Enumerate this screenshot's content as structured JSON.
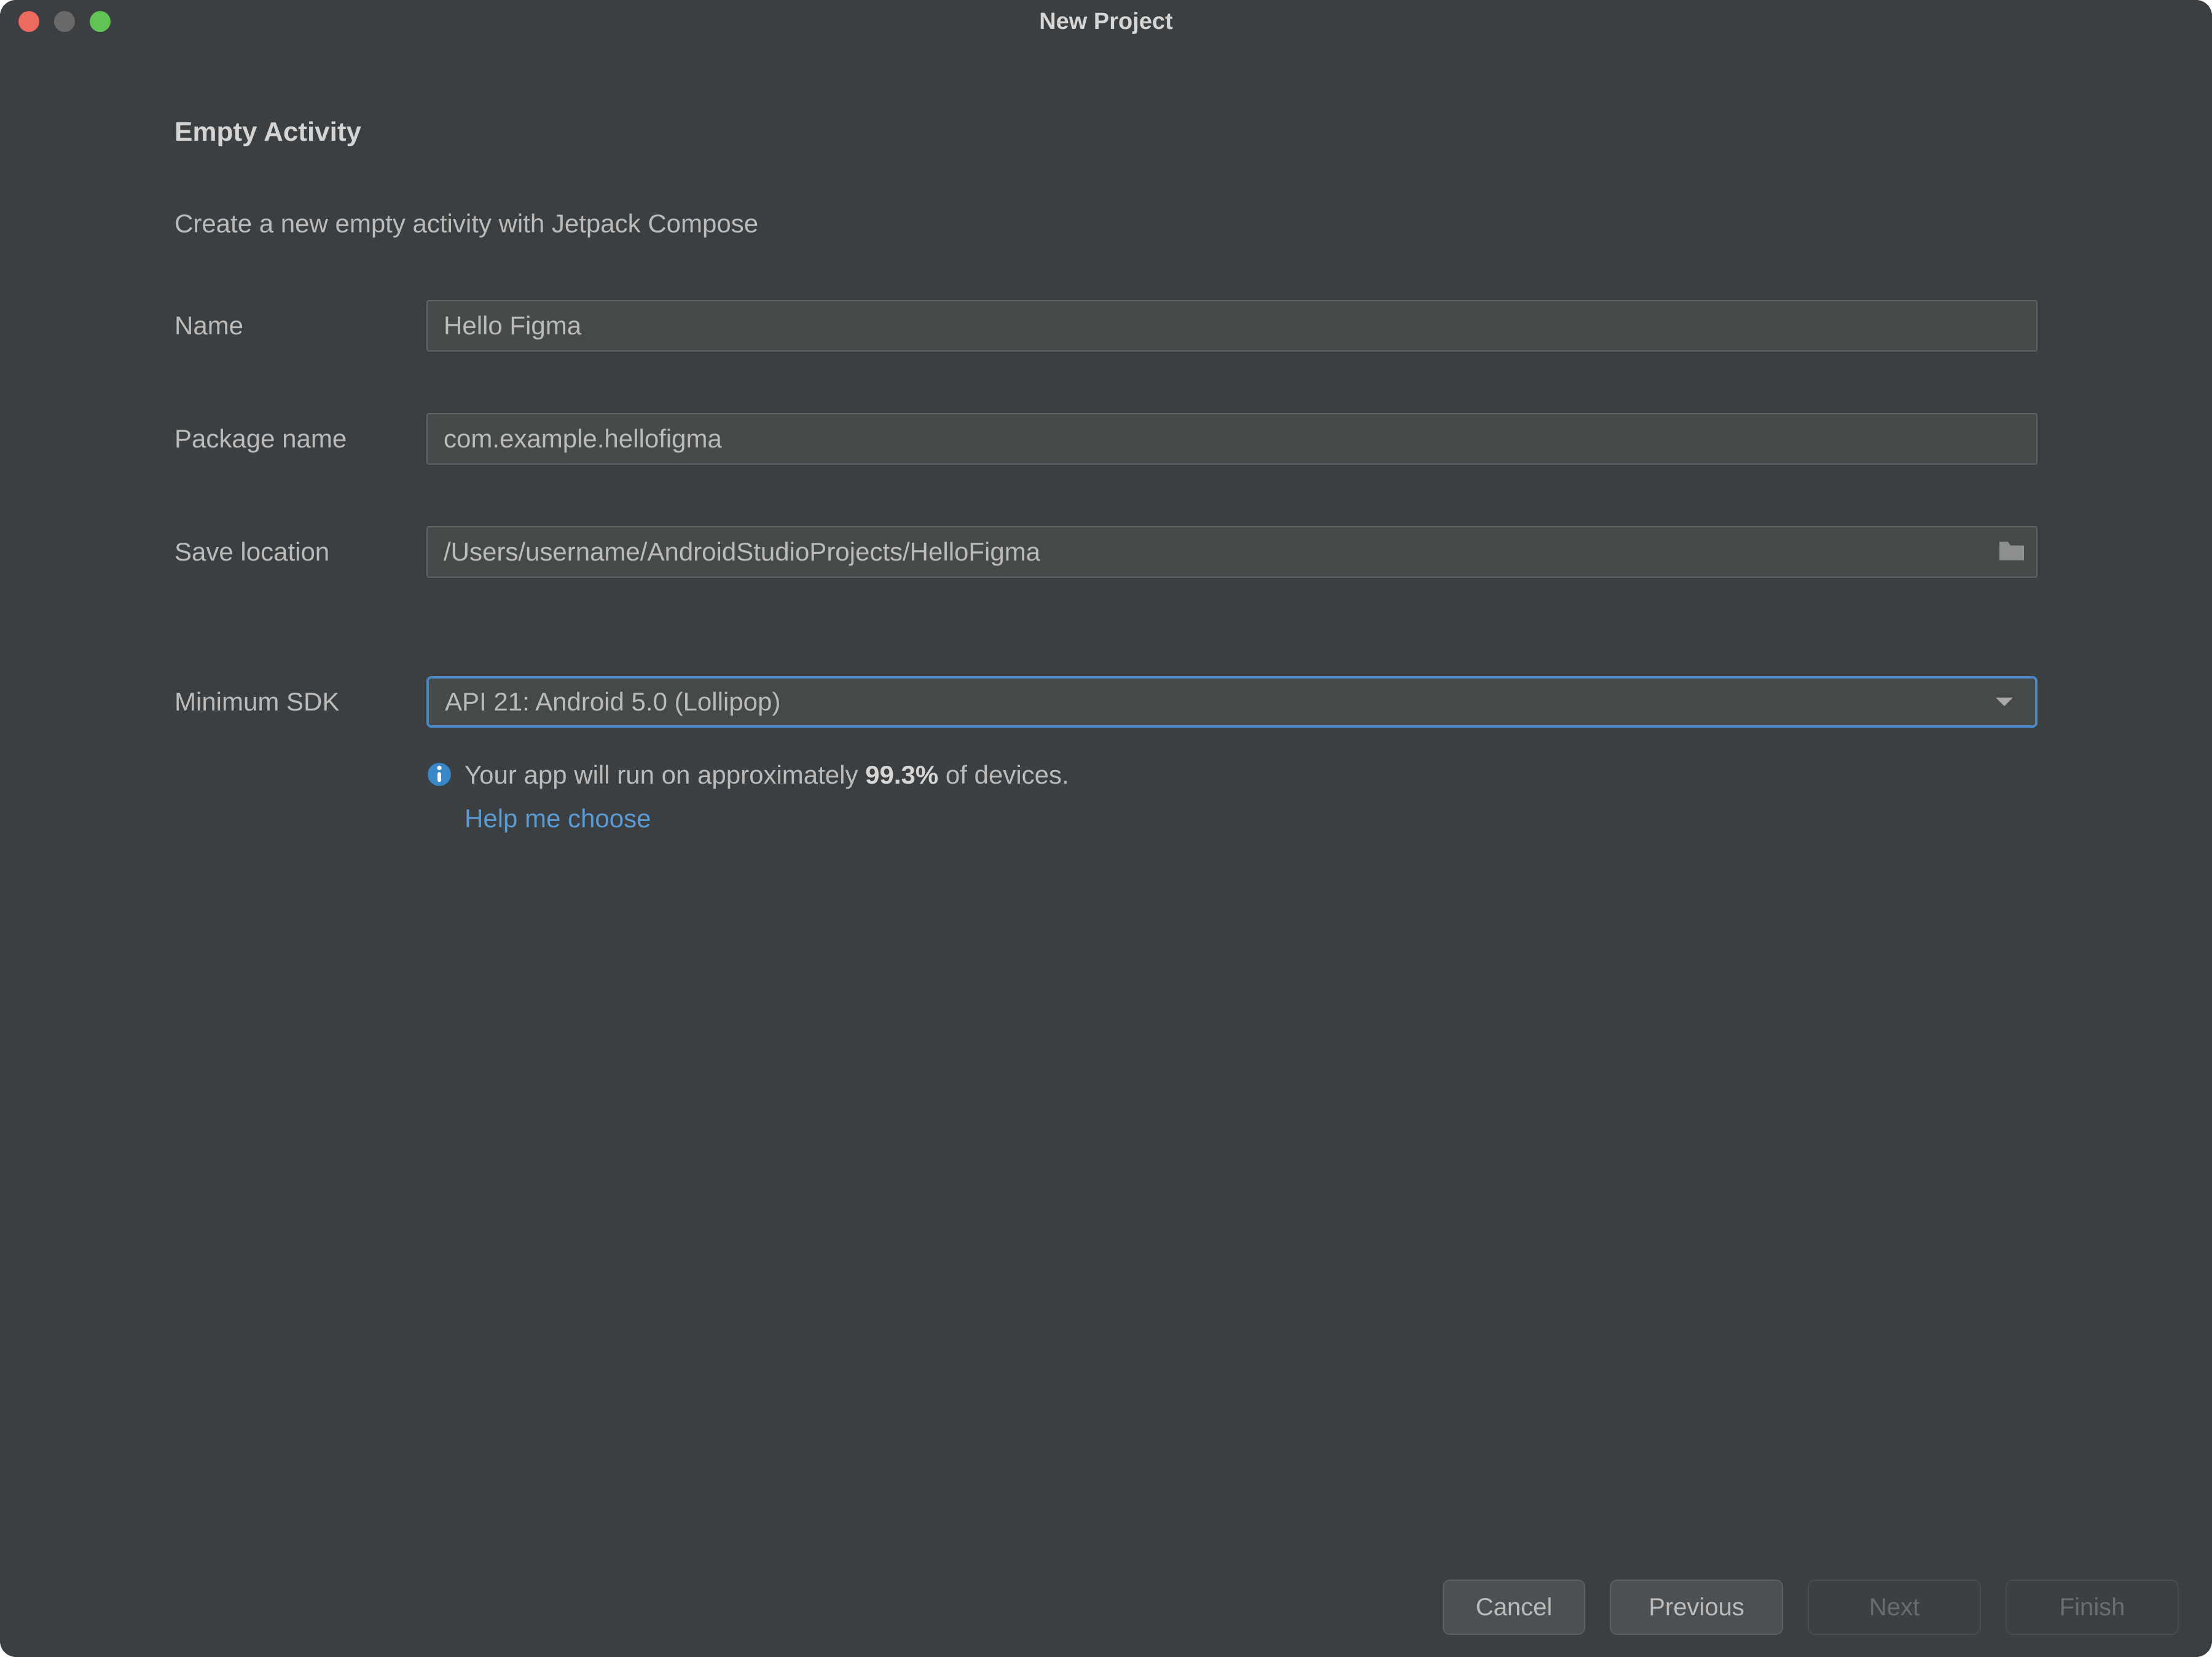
{
  "window": {
    "title": "New Project"
  },
  "heading": "Empty Activity",
  "subtitle": "Create a new empty activity with Jetpack Compose",
  "form": {
    "name": {
      "label": "Name",
      "value": "Hello Figma"
    },
    "package_name": {
      "label": "Package name",
      "value": "com.example.hellofigma"
    },
    "save_location": {
      "label": "Save location",
      "value": "/Users/username/AndroidStudioProjects/HelloFigma"
    },
    "minimum_sdk": {
      "label": "Minimum SDK",
      "value": "API 21: Android 5.0 (Lollipop)"
    }
  },
  "info": {
    "text_before": "Your app will run on approximately ",
    "percent": "99.3%",
    "text_after": " of devices.",
    "help_link": "Help me choose"
  },
  "footer": {
    "cancel": "Cancel",
    "previous": "Previous",
    "next": "Next",
    "finish": "Finish"
  }
}
